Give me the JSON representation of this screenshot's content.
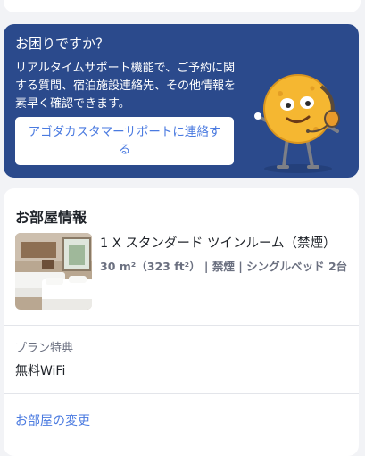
{
  "help": {
    "title": "お困りですか？",
    "body": "リアルタイムサポート機能で、ご予約に関する質問、宿泊施設連絡先、その他情報を素早く確認できます。",
    "contact_button_label": "アゴダカスタマーサポートに連絡する"
  },
  "room": {
    "section_title": "お部屋情報",
    "name": "1 X スタンダード ツインルーム（禁煙）",
    "details": "30 m²（323 ft²） | 禁煙 | シングルベッド 2台",
    "plan_label": "プラン特典",
    "plan_value": "無料WiFi",
    "change_link": "お部屋の変更"
  },
  "colors": {
    "help_background": "#2b4a8c",
    "link": "#4a7ae0",
    "page_background": "#f2f3f6"
  }
}
